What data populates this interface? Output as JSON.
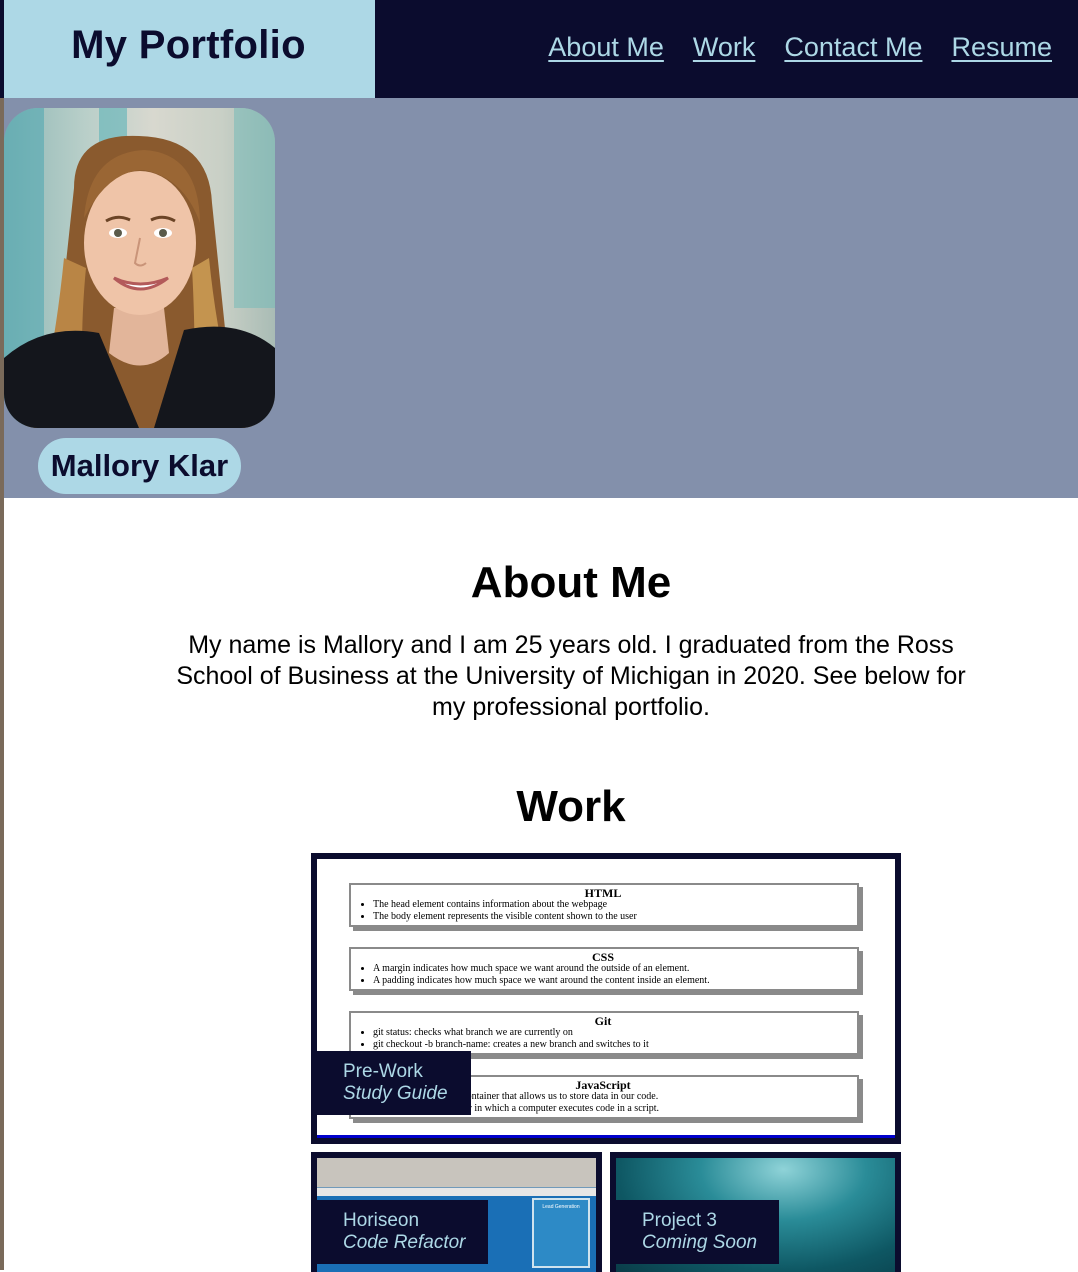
{
  "header": {
    "brand": "My Portfolio",
    "nav": [
      "About Me",
      "Work",
      "Contact Me",
      "Resume"
    ]
  },
  "hero": {
    "name": "Mallory Klar"
  },
  "about": {
    "title": "About Me",
    "text": "My name is Mallory and I am 25 years old. I graduated from the Ross School of Business at the University of Michigan in 2020. See below for my professional portfolio."
  },
  "work": {
    "title": "Work",
    "projects": [
      {
        "title": "Pre-Work",
        "subtitle": "Study Guide"
      },
      {
        "title": "Horiseon",
        "subtitle": "Code Refactor"
      },
      {
        "title": "Project 3",
        "subtitle": "Coming Soon"
      }
    ],
    "study_guide": [
      {
        "heading": "HTML",
        "items": [
          "The head element contains information about the webpage",
          "The body element represents the visible content shown to the user"
        ]
      },
      {
        "heading": "CSS",
        "items": [
          "A margin indicates how much space we want around the outside of an element.",
          "A padding indicates how much space we want around the content inside an element."
        ]
      },
      {
        "heading": "Git",
        "items": [
          "git status: checks what branch we are currently on",
          "git checkout -b branch-name: creates a new branch and switches to it"
        ]
      },
      {
        "heading": "JavaScript",
        "items": [
          "A variable is a named container that allows us to store data in our code.",
          "Control flow is the order in which a computer executes code in a script."
        ]
      }
    ],
    "horiseon_thumb_text": "Lead Generation"
  },
  "colors": {
    "navy": "#0b0c2e",
    "light_blue": "#add8e6",
    "hero_bg": "#8390ab"
  }
}
